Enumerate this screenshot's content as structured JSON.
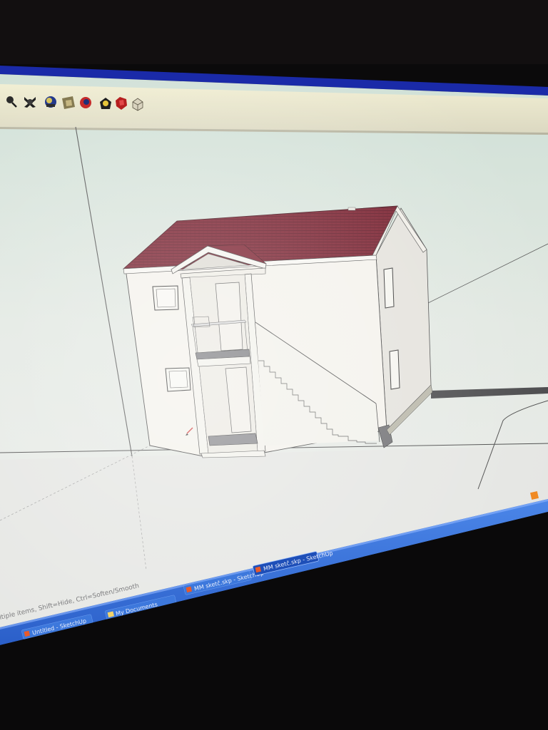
{
  "app": {
    "name": "SketchUp"
  },
  "status_bar": {
    "hint": "ltiple items, Shift=Hide, Ctrl=Soften/Smooth"
  },
  "taskbar": {
    "items": [
      {
        "label": "Untitled - SketchUp"
      },
      {
        "label": "My Documents"
      },
      {
        "label": "MM sketč.skp - SketchUp"
      },
      {
        "label": "MM sketč.skp - SketchUp"
      }
    ]
  },
  "toolbar": {
    "tools": [
      {
        "icon": "zoom-icon"
      },
      {
        "icon": "zoom-extents-icon"
      },
      {
        "icon": "get-models-icon"
      },
      {
        "icon": "share-model-icon"
      },
      {
        "icon": "component-icon"
      },
      {
        "icon": "extension-warehouse-icon"
      },
      {
        "icon": "ruby-icon"
      },
      {
        "icon": "box-icon"
      }
    ]
  },
  "scene": {
    "roof_color": "#7a1f2e",
    "wall_color": "#f4f2ec",
    "sky_top": "#cfe0d6",
    "sky_bottom": "#ececec",
    "ground_color": "#e4e5e2"
  }
}
